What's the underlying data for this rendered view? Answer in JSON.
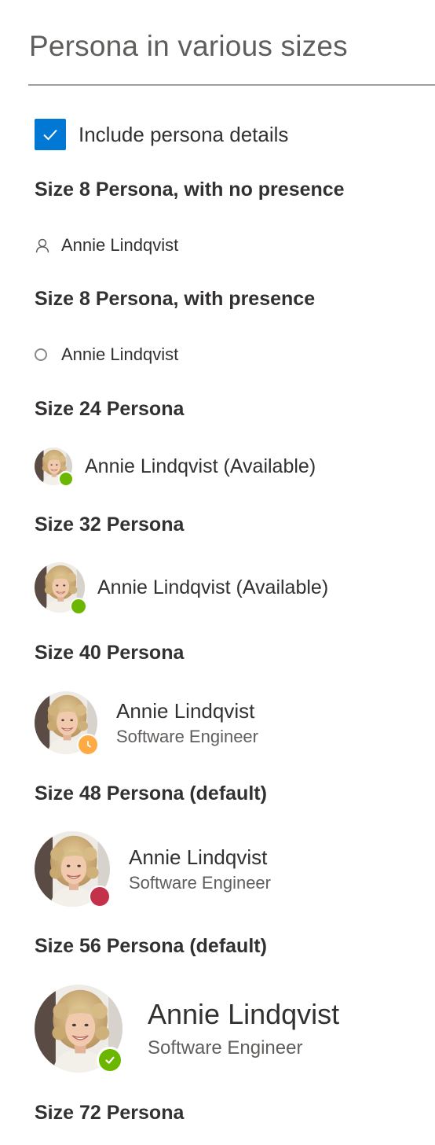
{
  "page": {
    "title": "Persona in various sizes"
  },
  "checkbox": {
    "label": "Include persona details",
    "checked": true,
    "accent": "#0078d4"
  },
  "presence_colors": {
    "available": "#6bb700",
    "away": "#ffaa44",
    "busy": "#c4314b",
    "offline": "#8a8886"
  },
  "sections": {
    "size8_no_presence": {
      "heading": "Size 8 Persona, with no presence",
      "name": "Annie Lindqvist",
      "icon": "contact-icon"
    },
    "size8_presence": {
      "heading": "Size 8 Persona, with presence",
      "name": "Annie Lindqvist",
      "presence": "offline"
    },
    "size24": {
      "heading": "Size 24 Persona",
      "name": "Annie Lindqvist (Available)",
      "presence": "available"
    },
    "size32": {
      "heading": "Size 32 Persona",
      "name": "Annie Lindqvist (Available)",
      "presence": "available"
    },
    "size40": {
      "heading": "Size 40 Persona",
      "name": "Annie Lindqvist",
      "secondary": "Software Engineer",
      "presence": "away",
      "presence_icon": "clock-icon"
    },
    "size48": {
      "heading": "Size 48 Persona (default)",
      "name": "Annie Lindqvist",
      "secondary": "Software Engineer",
      "presence": "busy"
    },
    "size56": {
      "heading": "Size 56 Persona (default)",
      "name": "Annie Lindqvist",
      "secondary": "Software Engineer",
      "presence": "available",
      "presence_icon": "checkmark-icon"
    },
    "size72": {
      "heading": "Size 72 Persona"
    }
  }
}
